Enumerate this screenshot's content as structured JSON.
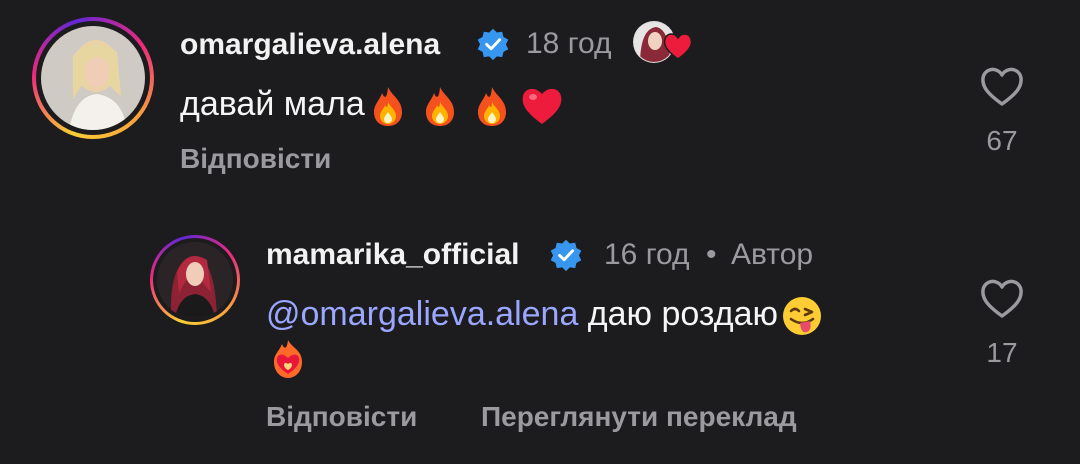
{
  "comments": [
    {
      "username": "omargalieva.alena",
      "time": "18 год",
      "text": "давай мала",
      "emojis": [
        "fire-icon",
        "fire-icon",
        "fire-icon",
        "red-heart-icon"
      ],
      "reply_label": "Відповісти",
      "like_count": "67",
      "liked_by_author": true
    },
    {
      "username": "mamarika_official",
      "time": "16 год",
      "separator": "•",
      "author_badge": "Автор",
      "mention": "@omargalieva.alena",
      "text": " даю роздаю",
      "emojis": [
        "winking-tongue-face-icon",
        "heart-on-fire-icon"
      ],
      "reply_label": "Відповісти",
      "translate_label": "Переглянути переклад",
      "like_count": "17"
    }
  ],
  "colors": {
    "background": "#1c1c1e",
    "verified": "#3797f0",
    "mention": "#9aa6ff",
    "muted": "#9a9a9f",
    "heart": "#ed1c3c"
  }
}
